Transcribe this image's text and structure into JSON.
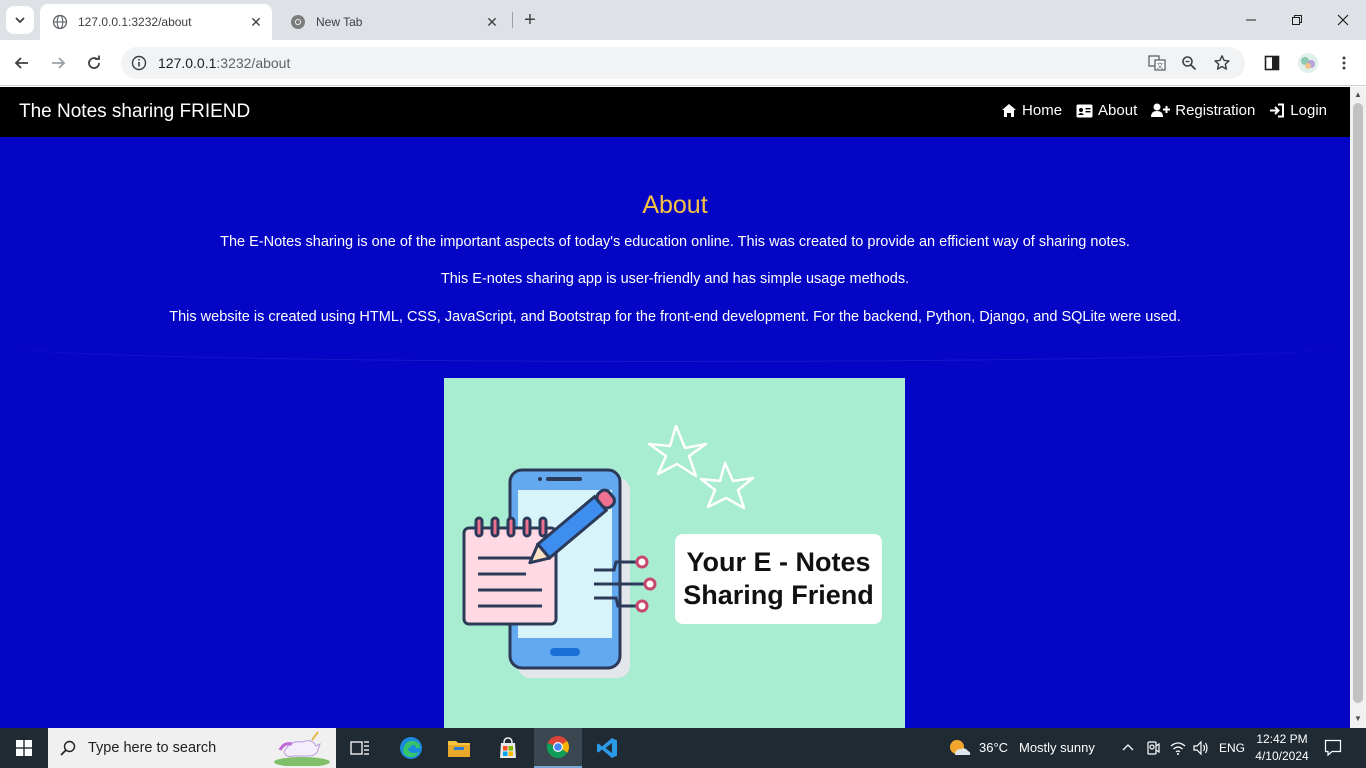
{
  "browser": {
    "tabs": [
      {
        "title": "127.0.0.1:3232/about",
        "active": true
      },
      {
        "title": "New Tab",
        "active": false
      }
    ],
    "url": {
      "host": "127.0.0.1",
      "rest": ":3232/about"
    }
  },
  "page": {
    "brand": "The Notes sharing FRIEND",
    "nav": [
      {
        "label": "Home",
        "icon": "home-icon"
      },
      {
        "label": "About",
        "icon": "id-card-icon"
      },
      {
        "label": "Registration",
        "icon": "user-plus-icon"
      },
      {
        "label": "Login",
        "icon": "login-icon"
      }
    ],
    "about_title": "About",
    "paragraphs": [
      "The E-Notes sharing is one of the important aspects of today's education online. This was created to provide an efficient way of sharing notes.",
      "This E-notes sharing app is user-friendly and has simple usage methods.",
      "This website is created using HTML, CSS, JavaScript, and Bootstrap for the front-end development. For the backend, Python, Django, and SQLite were used."
    ],
    "hero": {
      "line1": "Your E - Notes",
      "line2": "Sharing  Friend"
    }
  },
  "taskbar": {
    "search_placeholder": "Type here to search",
    "weather": {
      "temp": "36°C",
      "condition": "Mostly sunny"
    },
    "language": "ENG",
    "time": "12:42 PM",
    "date": "4/10/2024"
  },
  "colors": {
    "page_bg": "#0505c6",
    "navbar_bg": "#000000",
    "title_color": "#f5c242",
    "hero_bg": "#a8ecd2"
  }
}
